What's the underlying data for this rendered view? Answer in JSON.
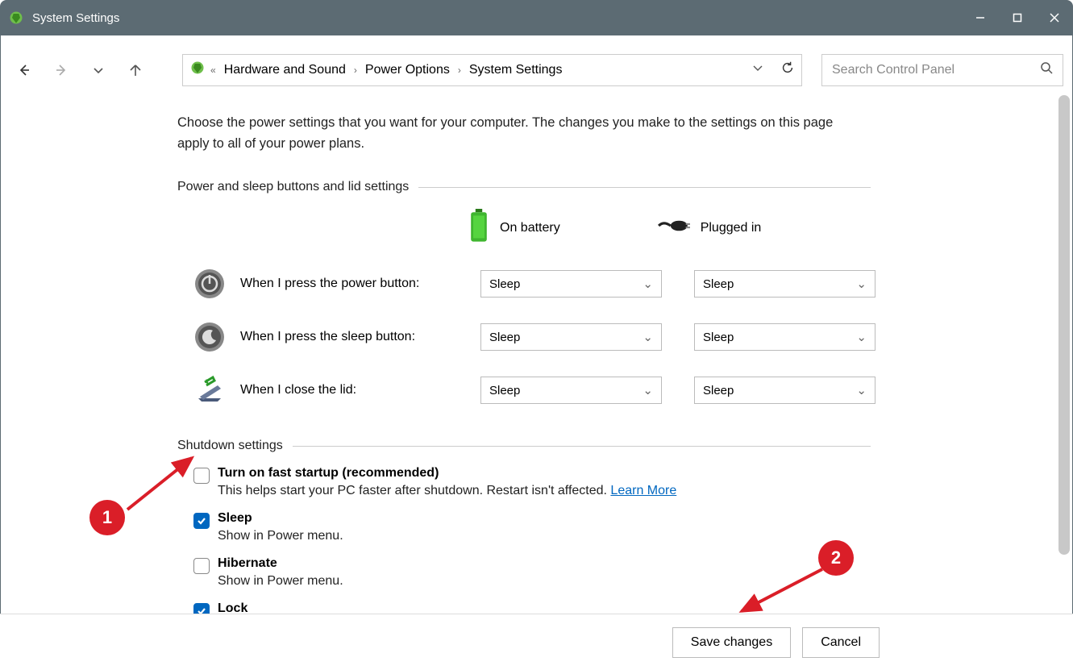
{
  "window": {
    "title": "System Settings"
  },
  "breadcrumb": {
    "items": [
      "Hardware and Sound",
      "Power Options",
      "System Settings"
    ]
  },
  "search": {
    "placeholder": "Search Control Panel"
  },
  "intro": "Choose the power settings that you want for your computer. The changes you make to the settings on this page apply to all of your power plans.",
  "sections": {
    "buttons": {
      "title": "Power and sleep buttons and lid settings",
      "columns": {
        "battery": "On battery",
        "plugged": "Plugged in"
      },
      "rows": [
        {
          "label": "When I press the power button:",
          "battery": "Sleep",
          "plugged": "Sleep"
        },
        {
          "label": "When I press the sleep button:",
          "battery": "Sleep",
          "plugged": "Sleep"
        },
        {
          "label": "When I close the lid:",
          "battery": "Sleep",
          "plugged": "Sleep"
        }
      ]
    },
    "shutdown": {
      "title": "Shutdown settings",
      "items": [
        {
          "title": "Turn on fast startup (recommended)",
          "sub": "This helps start your PC faster after shutdown. Restart isn't affected. ",
          "link": "Learn More",
          "checked": false
        },
        {
          "title": "Sleep",
          "sub": "Show in Power menu.",
          "checked": true
        },
        {
          "title": "Hibernate",
          "sub": "Show in Power menu.",
          "checked": false
        },
        {
          "title": "Lock",
          "sub": "",
          "checked": true
        }
      ]
    }
  },
  "footer": {
    "save": "Save changes",
    "cancel": "Cancel"
  },
  "annotations": {
    "one": "1",
    "two": "2"
  }
}
